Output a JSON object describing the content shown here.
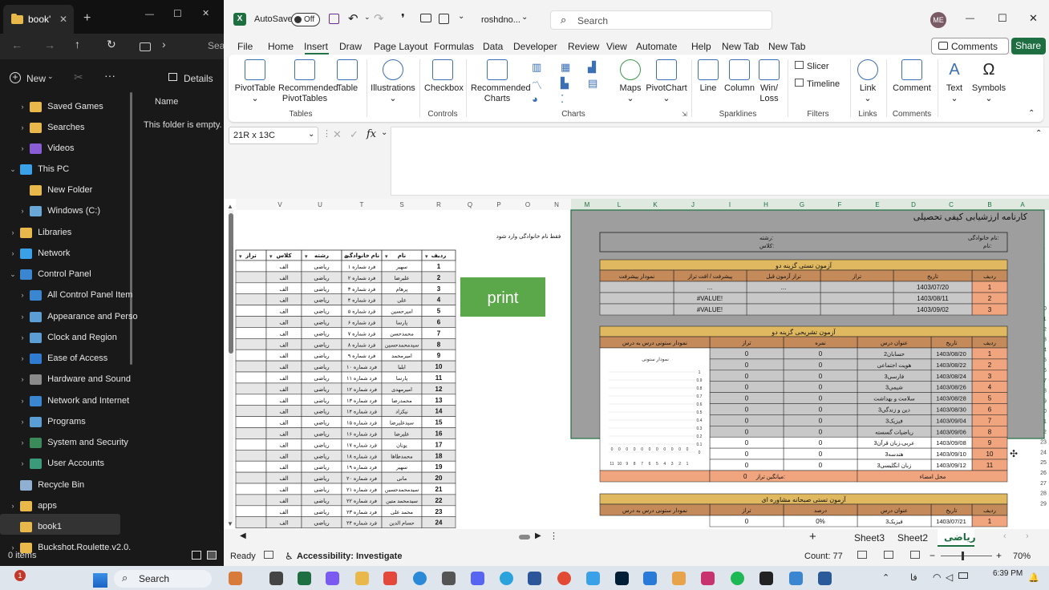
{
  "explorer": {
    "tab_title": "book'",
    "new_label": "New",
    "details_label": "Details",
    "search_label": "Sea",
    "column_name": "Name",
    "empty_msg": "This folder is empty.",
    "status": "0 items",
    "tree": [
      {
        "label": "Saved Games",
        "color": "#e8b94a"
      },
      {
        "label": "Searches",
        "color": "#e8b94a"
      },
      {
        "label": "Videos",
        "color": "#8a5cd6"
      },
      {
        "label": "This PC",
        "color": "#3aa0e8"
      },
      {
        "label": "New Folder",
        "color": "#e8b94a"
      },
      {
        "label": "Windows (C:)",
        "color": "#6aa8d8"
      },
      {
        "label": "Libraries",
        "color": "#e8b94a"
      },
      {
        "label": "Network",
        "color": "#3aa0e8"
      },
      {
        "label": "Control Panel",
        "color": "#3a86d0"
      },
      {
        "label": "All Control Panel Item",
        "color": "#3a86d0"
      },
      {
        "label": "Appearance and Perso",
        "color": "#5a9ed4"
      },
      {
        "label": "Clock and Region",
        "color": "#5a9ed4"
      },
      {
        "label": "Ease of Access",
        "color": "#2f7bd0"
      },
      {
        "label": "Hardware and Sound",
        "color": "#8a8a8a"
      },
      {
        "label": "Network and Internet",
        "color": "#3a86d0"
      },
      {
        "label": "Programs",
        "color": "#5a9ed4"
      },
      {
        "label": "System and Security",
        "color": "#3a8a5a"
      },
      {
        "label": "User Accounts",
        "color": "#3a9a7a"
      },
      {
        "label": "Recycle Bin",
        "color": "#8fb0d0"
      },
      {
        "label": "apps",
        "color": "#e8b94a"
      },
      {
        "label": "book1",
        "color": "#e8b94a"
      },
      {
        "label": "Buckshot.Roulette.v2.0.",
        "color": "#e8b94a"
      }
    ]
  },
  "excel": {
    "autosave": "AutoSave",
    "autosave_state": "Off",
    "filename": "roshdno...",
    "search_placeholder": "Search",
    "avatar": "ME",
    "comments_btn": "Comments",
    "share_btn": "Share",
    "menu": [
      "File",
      "Home",
      "Insert",
      "Draw",
      "Page Layout",
      "Formulas",
      "Data",
      "Developer",
      "Review",
      "View",
      "Automate",
      "Help",
      "New Tab",
      "New Tab"
    ],
    "active_menu": "Insert",
    "ribbon": {
      "pivot": "PivotTable",
      "rec_pivot1": "Recommended",
      "rec_pivot2": "PivotTables",
      "table": "Table",
      "illus": "Illustrations",
      "checkbox": "Checkbox",
      "rec_charts1": "Recommended",
      "rec_charts2": "Charts",
      "maps": "Maps",
      "pivotchart": "PivotChart",
      "line": "Line",
      "column": "Column",
      "winloss1": "Win/",
      "winloss2": "Loss",
      "slicer": "Slicer",
      "timeline": "Timeline",
      "link": "Link",
      "comment": "Comment",
      "text": "Text",
      "symbols": "Symbols",
      "groups": {
        "tables": "Tables",
        "controls": "Controls",
        "charts": "Charts",
        "sparklines": "Sparklines",
        "filters": "Filters",
        "links": "Links",
        "comments": "Comments"
      }
    },
    "namebox": "21R x 13C",
    "fx": "fx",
    "sheet_tabs": [
      "Sheet3",
      "Sheet2",
      "ریاضی"
    ],
    "status_ready": "Ready",
    "accessibility": "Accessibility: Investigate",
    "count": "Count: 77",
    "zoom": "70%",
    "print_button": "print",
    "filter_note": "فقط نام خانوادگی وارد شود",
    "left_columns": [
      "V",
      "U",
      "T",
      "S",
      "R",
      "Q",
      "P",
      "O",
      "N"
    ],
    "right_columns": [
      "M",
      "L",
      "K",
      "J",
      "I",
      "H",
      "G",
      "F",
      "E",
      "D",
      "C",
      "B",
      "A"
    ],
    "left_headers": [
      "تراز",
      "کلاس",
      "رشته",
      "نام خانوادگی",
      "نام",
      "ردیف"
    ],
    "students": [
      [
        "سهیر",
        "فرد شماره ۱"
      ],
      [
        "علیرضا",
        "فرد شماره ۲"
      ],
      [
        "پرهام",
        "فرد شماره ۳"
      ],
      [
        "علی",
        "فرد شماره ۴"
      ],
      [
        "امیرحسین",
        "فرد شماره ۵"
      ],
      [
        "پارسا",
        "فرد شماره ۶"
      ],
      [
        "محمدحسن",
        "فرد شماره ۷"
      ],
      [
        "سیدمحمدحسین",
        "فرد شماره ۸"
      ],
      [
        "امیرمحمد",
        "فرد شماره ۹"
      ],
      [
        "ایلیا",
        "فرد شماره ۱۰"
      ],
      [
        "پارسا",
        "فرد شماره ۱۱"
      ],
      [
        "امیرمهدی",
        "فرد شماره ۱۲"
      ],
      [
        "محمدرضا",
        "فرد شماره ۱۳"
      ],
      [
        "نیکزاد",
        "فرد شماره ۱۴"
      ],
      [
        "سیدعلیرضا",
        "فرد شماره ۱۵"
      ],
      [
        "علیرضا",
        "فرد شماره ۱۶"
      ],
      [
        "یونان",
        "فرد شماره ۱۷"
      ],
      [
        "محمدطاها",
        "فرد شماره ۱۸"
      ],
      [
        "سهیر",
        "فرد شماره ۱۹"
      ],
      [
        "مانی",
        "فرد شماره ۲۰"
      ],
      [
        "سیدمحمدحسین",
        "فرد شماره ۲۱"
      ],
      [
        "سیدمحمد متین",
        "فرد شماره ۲۲"
      ],
      [
        "محمد علی",
        "فرد شماره ۲۳"
      ],
      [
        "حسام الدین",
        "فرد شماره ۲۴"
      ]
    ],
    "class_val": "الف",
    "field_val": "ریاضی",
    "report": {
      "title": "کارنامه ارزشیابی کیفی تحصیلی",
      "lastname_label": "نام خانوادگی:",
      "name_label": "نام:",
      "field_label": "رشته:",
      "class_label": "کلاس:",
      "sec1_title": "آزمون تستی گزینه دو",
      "sec1_headers": [
        "ردیف",
        "تاریخ",
        "تراز",
        "تراز آزمون قبل",
        "پیشرفت / افت تراز",
        "نمودار پیشرفت"
      ],
      "sec1_rows": [
        [
          "1",
          "1403/07/20",
          "",
          "...",
          "..."
        ],
        [
          "2",
          "1403/08/11",
          "",
          "",
          "#VALUE!"
        ],
        [
          "3",
          "1403/09/02",
          "",
          "",
          "#VALUE!"
        ]
      ],
      "sec2_title": "آزمون تشریحی گزینه دو",
      "sec2_headers": [
        "ردیف",
        "تاریخ",
        "عنوان درس",
        "نمره",
        "تراز",
        "نمودار ستونی درس به درس"
      ],
      "sec2_rows": [
        [
          "1",
          "1403/08/20",
          "حسابان2",
          "0",
          "0"
        ],
        [
          "2",
          "1403/08/22",
          "هویت اجتماعی",
          "0",
          "0"
        ],
        [
          "3",
          "1403/08/24",
          "فارسی3",
          "0",
          "0"
        ],
        [
          "4",
          "1403/08/26",
          "شیمی3",
          "0",
          "0"
        ],
        [
          "5",
          "1403/08/28",
          "سلامت و بهداشت",
          "0",
          "0"
        ],
        [
          "6",
          "1403/08/30",
          "دین و زندگی3",
          "0",
          "0"
        ],
        [
          "7",
          "1403/09/04",
          "فیزیک3",
          "0",
          "0"
        ],
        [
          "8",
          "1403/09/06",
          "ریاضیات گسسته",
          "0",
          "0"
        ],
        [
          "9",
          "1403/09/08",
          "عربی،زبان قرآن3",
          "0",
          "0"
        ],
        [
          "10",
          "1403/09/10",
          "هندسه3",
          "0",
          "0"
        ],
        [
          "11",
          "1403/09/12",
          "زبان انگلیسی3",
          "0",
          "0"
        ]
      ],
      "avg_label": "میانگین تراز:",
      "avg_val": "0",
      "signature_label": "محل امضاء",
      "mini_chart_title": "نمودار ستونی",
      "mini_yticks": [
        "1",
        "0.9",
        "0.8",
        "0.7",
        "0.6",
        "0.5",
        "0.4",
        "0.3",
        "0.2",
        "0.1",
        "0"
      ],
      "mini_xticks": [
        "11",
        "10",
        "9",
        "8",
        "7",
        "6",
        "5",
        "4",
        "3",
        "2",
        "1"
      ],
      "sec3_title": "آزمون تستی صبحانه مشاوره ای",
      "sec3_headers": [
        "ردیف",
        "تاریخ",
        "عنوان درس",
        "درصد",
        "تراز",
        "نمودار ستونی درس به درس"
      ],
      "sec3_rows": [
        [
          "1",
          "1403/07/21",
          "فیزیک3",
          "0%",
          "0"
        ]
      ]
    }
  },
  "taskbar": {
    "search": "Search",
    "time": "6:39 PM",
    "notification_count": "1"
  }
}
